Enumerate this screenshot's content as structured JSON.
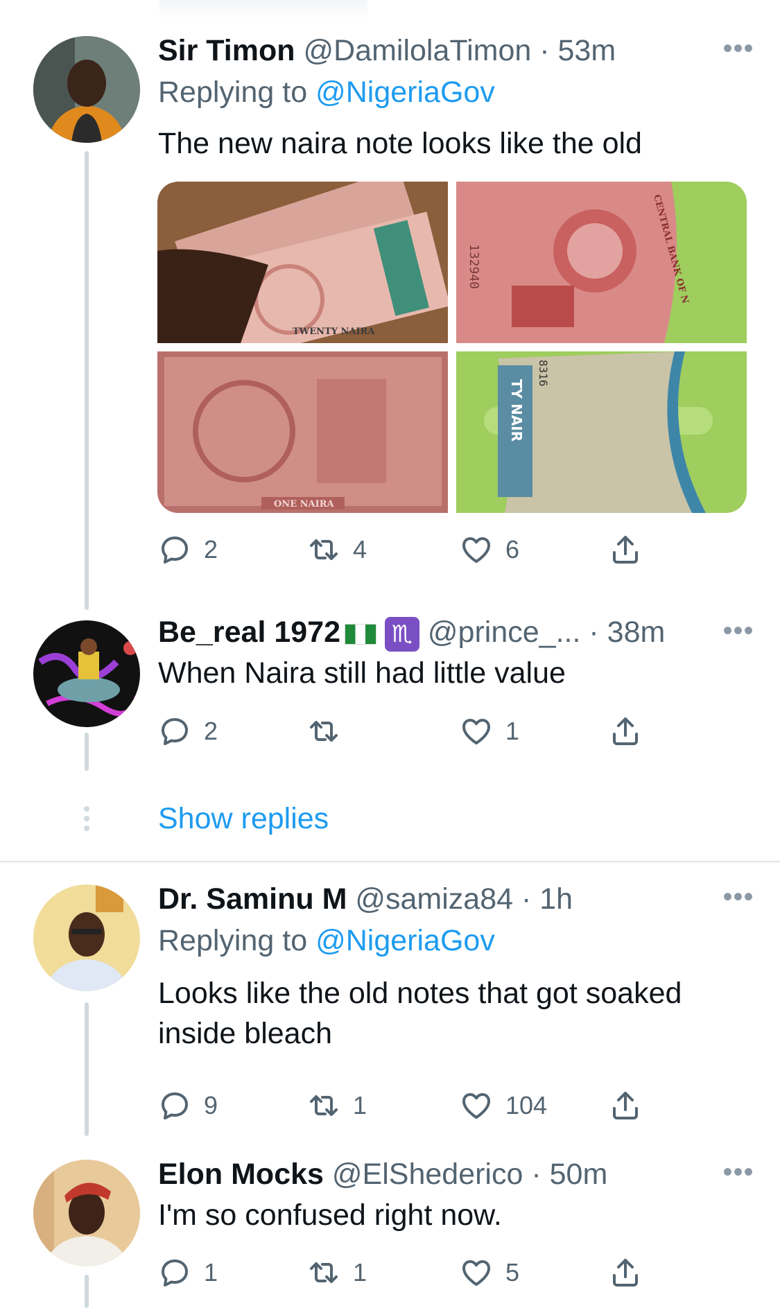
{
  "tweets": [
    {
      "name": "Sir Timon",
      "handle": "@DamilolaTimon",
      "time": "53m",
      "replying_label": "Replying to",
      "replying_to": "@NigeriaGov",
      "text": "The new naira note looks like the old",
      "media": [
        {
          "alt": "TWENTY NAIRA",
          "label": "TWENTY NAIRA"
        },
        {
          "alt": "CENTRAL BANK OF NIGERIA",
          "label": "CENTRAL BANK OF N",
          "serial": "132940"
        },
        {
          "alt": "ONE NAIRA",
          "label": "ONE NAIRA"
        },
        {
          "alt": "TWENTY NAIRA worn note",
          "label": "TY NAIR",
          "serial": "8316"
        }
      ],
      "replies": "2",
      "retweets": "4",
      "likes": "6"
    },
    {
      "name": "Be_real 1972",
      "emoji": "♏",
      "handle": "@prince_...",
      "time": "38m",
      "text": "When Naira still had little value",
      "replies": "2",
      "retweets": "",
      "likes": "1"
    },
    {
      "show_replies": "Show replies"
    },
    {
      "name": "Dr. Saminu M",
      "handle": "@samiza84",
      "time": "1h",
      "replying_label": "Replying to",
      "replying_to": "@NigeriaGov",
      "text": "Looks like the old notes that got soaked inside bleach",
      "replies": "9",
      "retweets": "1",
      "likes": "104"
    },
    {
      "name": "Elon Mocks",
      "handle": "@ElShederico",
      "time": "50m",
      "text": "I'm so confused right now.",
      "replies": "1",
      "retweets": "1",
      "likes": "5"
    }
  ],
  "colors": {
    "accent": "#1d9bf0",
    "secondary_text": "#536471",
    "thread_line": "#cfd9de"
  },
  "icons": [
    "reply-icon",
    "retweet-icon",
    "like-icon",
    "share-icon",
    "more-icon"
  ]
}
